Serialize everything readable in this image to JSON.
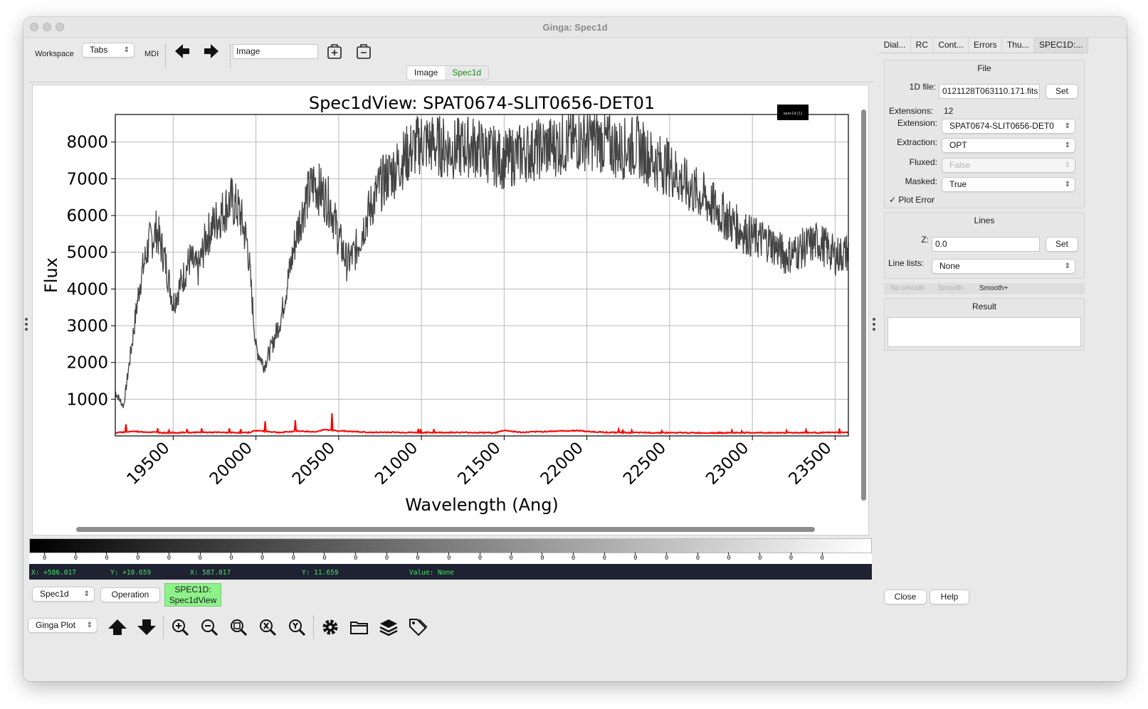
{
  "window": {
    "title": "Ginga: Spec1d"
  },
  "toolbar": {
    "workspace_label": "Workspace",
    "workspace_mode": "Tabs",
    "mdi_label": "MDI",
    "workspace_name": "Image"
  },
  "channel_tabs": [
    {
      "label": "Image",
      "active": false
    },
    {
      "label": "Spec1d",
      "active": true
    }
  ],
  "chart_data": {
    "type": "line",
    "title": "Spec1dView: SPAT0674-SLIT0656-DET01",
    "xlabel": "Wavelength (Ang)",
    "ylabel": "Flux",
    "xlim": [
      19150,
      23580
    ],
    "ylim": [
      0,
      8750
    ],
    "x_ticks": [
      19500,
      20000,
      20500,
      21000,
      21500,
      22000,
      22500,
      23000,
      23500
    ],
    "y_ticks": [
      1000,
      2000,
      3000,
      4000,
      5000,
      6000,
      7000,
      8000
    ],
    "grid": true,
    "legend": {
      "text": "spec1d [1]",
      "placement": "top-right"
    },
    "series": [
      {
        "color": "#444444",
        "x": [
          19150,
          19200,
          19250,
          19300,
          19350,
          19400,
          19450,
          19500,
          19550,
          19600,
          19650,
          19700,
          19750,
          19800,
          19850,
          19900,
          19950,
          20000,
          20050,
          20100,
          20150,
          20200,
          20250,
          20300,
          20350,
          20400,
          20450,
          20500,
          20550,
          20600,
          20650,
          20700,
          20750,
          20800,
          20850,
          20900,
          20950,
          21000,
          21100,
          21200,
          21300,
          21400,
          21500,
          21600,
          21700,
          21800,
          21900,
          22000,
          22100,
          22200,
          22300,
          22400,
          22500,
          22600,
          22700,
          22800,
          22900,
          23000,
          23100,
          23200,
          23300,
          23400,
          23500,
          23580
        ],
        "y": [
          1200,
          800,
          2500,
          4200,
          5200,
          5600,
          4800,
          3600,
          4200,
          4800,
          4500,
          5400,
          5800,
          6100,
          6400,
          6100,
          5200,
          2400,
          1900,
          2500,
          3200,
          4400,
          5600,
          6400,
          6900,
          6600,
          6300,
          5400,
          4700,
          5000,
          5700,
          6300,
          6800,
          7100,
          7300,
          7600,
          7800,
          8000,
          7900,
          7800,
          7900,
          7700,
          7500,
          7700,
          7800,
          7900,
          8000,
          8100,
          8000,
          7800,
          7900,
          7500,
          7300,
          6800,
          6500,
          6100,
          5700,
          5400,
          5300,
          4900,
          5100,
          5300,
          4900,
          5000
        ]
      },
      {
        "color": "#ff0000",
        "x": [
          19150,
          19250,
          19450,
          19700,
          19950,
          20000,
          20150,
          20250,
          20350,
          20420,
          20500,
          20700,
          20800,
          21000,
          21200,
          21450,
          21500,
          21600,
          21800,
          21950,
          22000,
          22150,
          22300,
          22500,
          22700,
          23000,
          23300,
          23580
        ],
        "y": [
          60,
          330,
          80,
          150,
          90,
          480,
          110,
          400,
          250,
          620,
          430,
          120,
          180,
          100,
          140,
          90,
          520,
          140,
          360,
          480,
          300,
          120,
          90,
          80,
          60,
          80,
          90,
          120
        ]
      }
    ]
  },
  "colorbar": {
    "tick_labels": [
      "0",
      "0",
      "0",
      "0",
      "0",
      "0",
      "0",
      "0",
      "0",
      "0",
      "0",
      "0",
      "0",
      "0",
      "0",
      "0",
      "0",
      "0",
      "0",
      "0",
      "0",
      "0",
      "0",
      "0",
      "0",
      "0"
    ]
  },
  "readout": {
    "x": "X: +586.017",
    "y": "Y: +10.659",
    "x2": "X: 587.017",
    "y2": "Y: 11.659",
    "value": "Value: None"
  },
  "channel_bar": {
    "channel": "Spec1d",
    "operation": "Operation",
    "plugin_line1": "SPEC1D:",
    "plugin_line2": "Spec1dView"
  },
  "bottom_toolbar": {
    "mode": "Ginga Plot"
  },
  "right_panel": {
    "tabs": [
      "Dial...",
      "RC",
      "Cont...",
      "Errors",
      "Thu...",
      "SPEC1D:..."
    ],
    "file": {
      "title": "File",
      "file_label": "1D file:",
      "file_value": "0121128T063110.171.fits",
      "set_label": "Set",
      "extensions_label": "Extensions:",
      "extensions_value": "12",
      "extension_label": "Extension:",
      "extension_value": "SPAT0674-SLIT0656-DET0",
      "extraction_label": "Extraction:",
      "extraction_value": "OPT",
      "fluxed_label": "Fluxed:",
      "fluxed_value": "False",
      "masked_label": "Masked:",
      "masked_value": "True",
      "plot_error_label": "Plot Error",
      "plot_error_checked": true
    },
    "lines": {
      "title": "Lines",
      "z_label": "Z:",
      "z_value": "0.0",
      "set_label": "Set",
      "line_lists_label": "Line lists:",
      "line_lists_value": "None"
    },
    "smoothing": [
      "No smooth",
      "Smooth-",
      "Smooth+"
    ],
    "result": {
      "title": "Result",
      "value": ""
    },
    "close_label": "Close",
    "help_label": "Help"
  }
}
